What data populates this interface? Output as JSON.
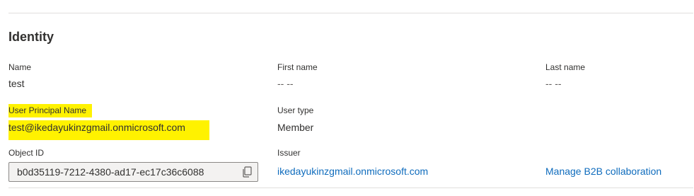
{
  "section": {
    "title": "Identity"
  },
  "fields": {
    "name": {
      "label": "Name",
      "value": "test"
    },
    "first_name": {
      "label": "First name",
      "value": "-- --"
    },
    "last_name": {
      "label": "Last name",
      "value": "-- --"
    },
    "upn": {
      "label": "User Principal Name",
      "value": "test@ikedayukinzgmail.onmicrosoft.com"
    },
    "user_type": {
      "label": "User type",
      "value": "Member"
    },
    "object_id": {
      "label": "Object ID",
      "value": "b0d35119-7212-4380-ad17-ec17c36c6088"
    },
    "issuer": {
      "label": "Issuer",
      "value": "ikedayukinzgmail.onmicrosoft.com"
    }
  },
  "links": {
    "manage_b2b": "Manage B2B collaboration"
  },
  "icons": {
    "copy": "copy-icon"
  },
  "colors": {
    "link": "#0f6cbd",
    "highlight": "#fff200",
    "text": "#323130"
  }
}
